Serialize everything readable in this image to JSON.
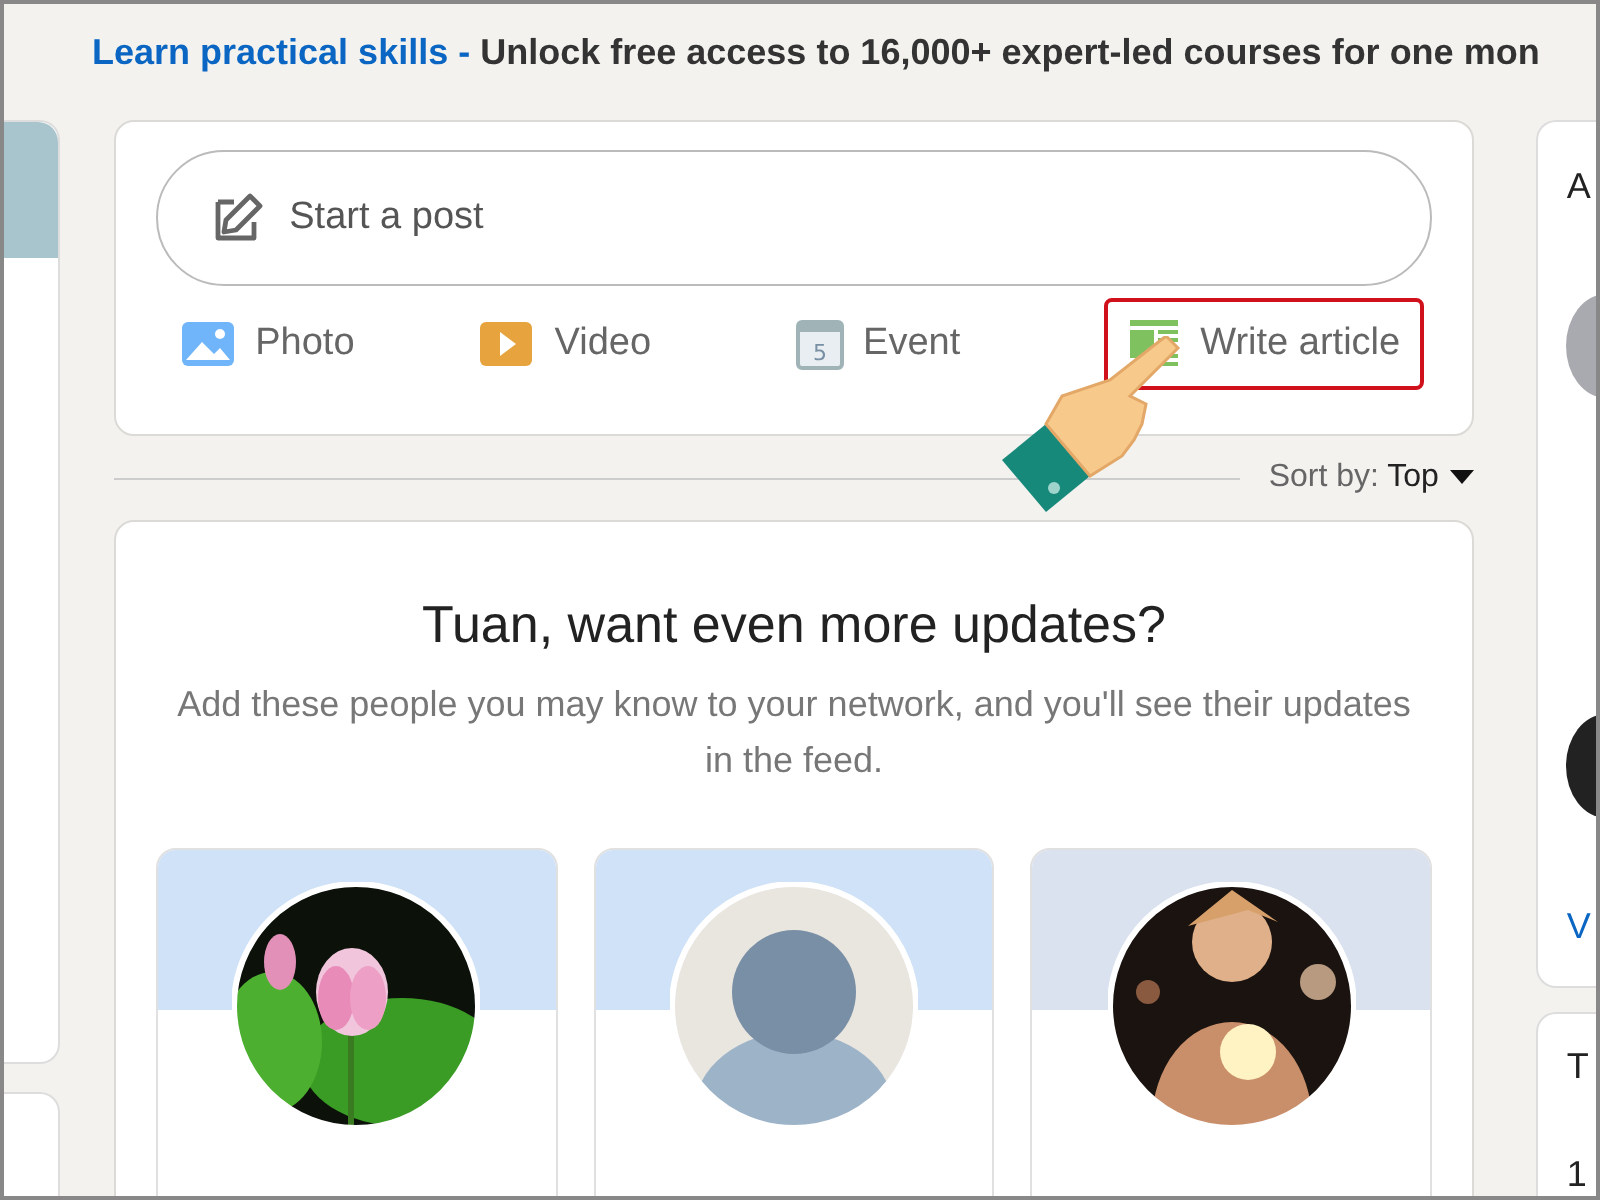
{
  "banner": {
    "link": "Learn practical skills -",
    "text": "Unlock free access to 16,000+ expert-led courses for one mon"
  },
  "composer": {
    "placeholder": "Start a post",
    "actions": [
      {
        "label": "Photo",
        "selected": false
      },
      {
        "kind": "video",
        "label": "Video",
        "selected": false
      },
      {
        "kind": "event",
        "label": "Event",
        "selected": false,
        "day": "5"
      },
      {
        "kind": "article",
        "label": "Write article",
        "selected": true
      }
    ]
  },
  "sort": {
    "label": "Sort by:",
    "value": "Top"
  },
  "updates": {
    "title": "Tuan, want even more updates?",
    "text": "Add these people you may know to your network, and you'll see their updates in the feed.",
    "people": [
      {
        "kind": "picture",
        "color": "#cfe2f7"
      },
      {
        "kind": "silhouette",
        "color": "#cfe2f7"
      },
      {
        "kind": "picture",
        "color": "#d9e2ee"
      }
    ]
  },
  "right_rail": {
    "heading": "A",
    "link": "V",
    "card_title": "T",
    "card_text": "1"
  }
}
